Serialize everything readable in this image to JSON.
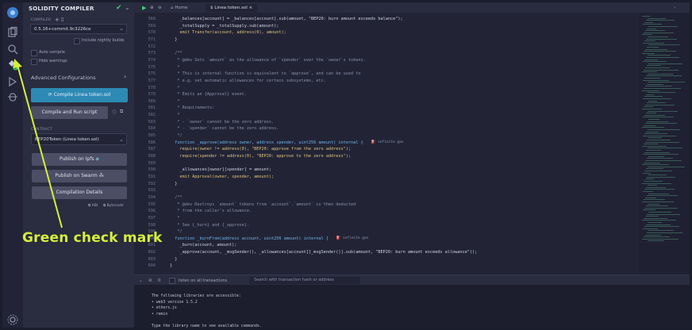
{
  "app": {
    "panel_title": "SOLIDITY COMPILER"
  },
  "compiler": {
    "label": "COMPILER",
    "version": "0.5.16+commit.9c3226ce",
    "include_nightly": "Include nightly builds",
    "auto_compile": "Auto compile",
    "hide_warnings": "Hide warnings",
    "advanced": "Advanced Configurations",
    "compile_button": "Compile Linea token.sol",
    "compile_run_button": "Compile and Run script",
    "contract_label": "CONTRACT",
    "contract_value": "BEP20Token (Linea token.sol)",
    "publish_ipfs": "Publish on Ipfs",
    "publish_swarm": "Publish on Swarm",
    "compilation_details": "Compilation Details",
    "abi": "ABI",
    "bytecode": "Bytecode"
  },
  "tabs": [
    {
      "label": "Home"
    },
    {
      "label": "Linea token.sol"
    }
  ],
  "editor": {
    "lines": [
      {
        "n": "568",
        "text": "    _balances[account] = _balances[account].sub(amount, \"BEP20: burn amount exceeds balance\");"
      },
      {
        "n": "569",
        "text": "    _totalSupply = _totalSupply.sub(amount);"
      },
      {
        "n": "570",
        "text": "    emit Transfer(account, address(0), amount);"
      },
      {
        "n": "571",
        "text": "  }"
      },
      {
        "n": "572",
        "text": ""
      },
      {
        "n": "573",
        "text": "  /**"
      },
      {
        "n": "574",
        "text": "   * @dev Sets `amount` as the allowance of `spender` over the `owner`s tokens."
      },
      {
        "n": "575",
        "text": "   *"
      },
      {
        "n": "576",
        "text": "   * This is internal function is equivalent to `approve`, and can be used to"
      },
      {
        "n": "577",
        "text": "   * e.g. set automatic allowances for certain subsystems, etc."
      },
      {
        "n": "578",
        "text": "   *"
      },
      {
        "n": "579",
        "text": "   * Emits an {Approval} event."
      },
      {
        "n": "580",
        "text": "   *"
      },
      {
        "n": "581",
        "text": "   * Requirements:"
      },
      {
        "n": "582",
        "text": "   *"
      },
      {
        "n": "583",
        "text": "   * - `owner` cannot be the zero address."
      },
      {
        "n": "584",
        "text": "   * - `spender` cannot be the zero address."
      },
      {
        "n": "585",
        "text": "   */"
      },
      {
        "n": "586",
        "text": "  function _approve(address owner, address spender, uint256 amount) internal {",
        "badge": "infinite gas"
      },
      {
        "n": "587",
        "text": "    require(owner != address(0), \"BEP20: approve from the zero address\");"
      },
      {
        "n": "588",
        "text": "    require(spender != address(0), \"BEP20: approve to the zero address\");"
      },
      {
        "n": "589",
        "text": ""
      },
      {
        "n": "590",
        "text": "    _allowances[owner][spender] = amount;"
      },
      {
        "n": "591",
        "text": "    emit Approval(owner, spender, amount);"
      },
      {
        "n": "592",
        "text": "  }"
      },
      {
        "n": "593",
        "text": ""
      },
      {
        "n": "594",
        "text": "  /**"
      },
      {
        "n": "595",
        "text": "   * @dev Destroys `amount` tokens from `account`.`amount` is then deducted"
      },
      {
        "n": "596",
        "text": "   * from the caller's allowance."
      },
      {
        "n": "597",
        "text": "   *"
      },
      {
        "n": "598",
        "text": "   * See {_burn} and {_approve}."
      },
      {
        "n": "599",
        "text": "   */"
      },
      {
        "n": "600",
        "text": "  function _burnFrom(address account, uint256 amount) internal {",
        "badge": "infinite gas"
      },
      {
        "n": "601",
        "text": "    _burn(account, amount);"
      },
      {
        "n": "602",
        "text": "    _approve(account, _msgSender(), _allowances[account][_msgSender()].sub(amount, \"BEP20: burn amount exceeds allowance\"));"
      },
      {
        "n": "603",
        "text": "  }"
      },
      {
        "n": "604",
        "text": "}"
      }
    ]
  },
  "terminal": {
    "listen_label": "listen on all transactions",
    "search_placeholder": "Search with transaction hash or address",
    "lines": [
      "The following libraries are accessible:",
      "• web3 version 1.5.2",
      "• ethers.js",
      "• remix",
      "",
      "Type the library name to see available commands."
    ]
  },
  "annotation": {
    "text": "Green check mark"
  },
  "colors": {
    "check_green": "#3fd071",
    "annotation_yellow": "#d6f03a",
    "primary_button": "#2c8ab4"
  }
}
